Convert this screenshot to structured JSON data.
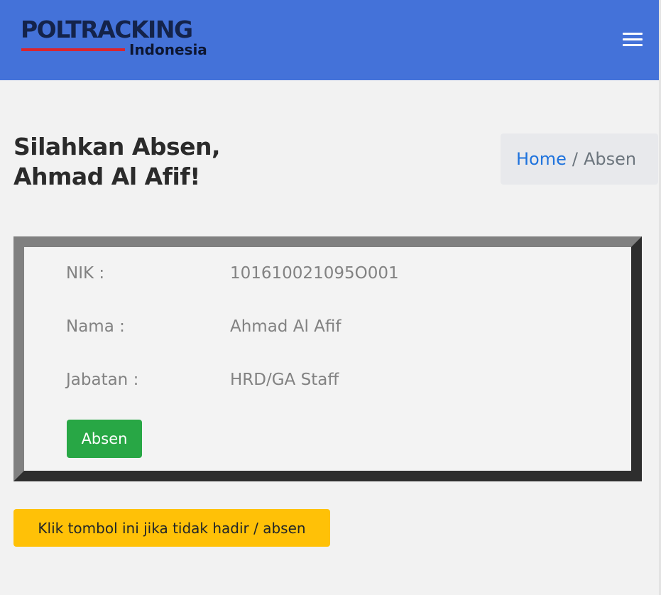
{
  "header": {
    "logo_title": "POLTRACKING",
    "logo_subtitle": "Indonesia",
    "menu_icon": "hamburger-menu-icon",
    "background_color": "#4472d9"
  },
  "page": {
    "title_line1": "Silahkan Absen,",
    "title_line2": "Ahmad Al Afif!"
  },
  "breadcrumb": {
    "items": [
      "Home",
      "Absen"
    ],
    "separator": "/"
  },
  "employee": {
    "fields": [
      {
        "label": "NIK :",
        "value": "101610021095O001"
      },
      {
        "label": "Nama :",
        "value": "Ahmad Al Afif"
      },
      {
        "label": "Jabatan :",
        "value": "HRD/GA Staff"
      }
    ],
    "submit_label": "Absen",
    "submit_color": "#28a745"
  },
  "absent_button": {
    "label": "Klik tombol ini jika tidak hadir / absen",
    "color": "#ffc107"
  }
}
